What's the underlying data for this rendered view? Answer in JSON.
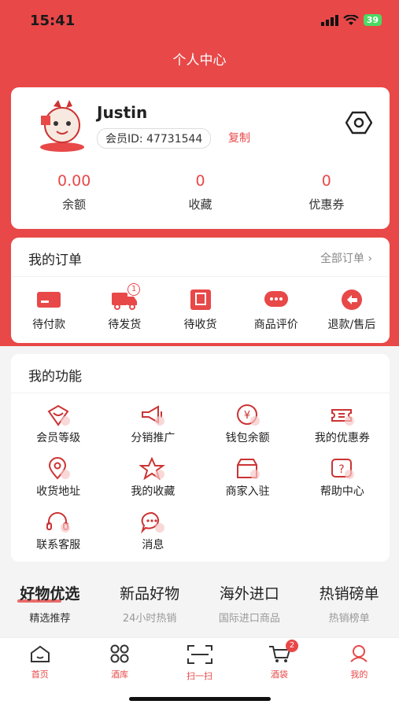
{
  "status": {
    "time": "15:41",
    "battery": "39"
  },
  "page_title": "个人中心",
  "profile": {
    "username": "Justin",
    "member_id": "会员ID: 47731544",
    "copy_label": "复制",
    "stats": [
      {
        "value": "0.00",
        "label": "余额"
      },
      {
        "value": "0",
        "label": "收藏"
      },
      {
        "value": "0",
        "label": "优惠券"
      }
    ]
  },
  "orders": {
    "title": "我的订单",
    "all_label": "全部订单 ›",
    "items": [
      {
        "label": "待付款",
        "icon": "card-icon"
      },
      {
        "label": "待发货",
        "icon": "truck-icon",
        "badge": "1"
      },
      {
        "label": "待收货",
        "icon": "box-icon"
      },
      {
        "label": "商品评价",
        "icon": "chat-icon"
      },
      {
        "label": "退款/售后",
        "icon": "return-icon"
      }
    ]
  },
  "functions": {
    "title": "我的功能",
    "items": [
      {
        "label": "会员等级"
      },
      {
        "label": "分销推广"
      },
      {
        "label": "钱包余额"
      },
      {
        "label": "我的优惠券"
      },
      {
        "label": "收货地址"
      },
      {
        "label": "我的收藏"
      },
      {
        "label": "商家入驻"
      },
      {
        "label": "帮助中心"
      },
      {
        "label": "联系客服"
      },
      {
        "label": "消息"
      }
    ]
  },
  "tabs": [
    {
      "title": "好物优选",
      "sub": "精选推荐"
    },
    {
      "title": "新品好物",
      "sub": "24小时热销"
    },
    {
      "title": "海外进口",
      "sub": "国际进口商品"
    },
    {
      "title": "热销磅单",
      "sub": "热销榜单"
    }
  ],
  "bottom_nav": [
    {
      "label": "首页"
    },
    {
      "label": "酒库"
    },
    {
      "label": "扫一扫"
    },
    {
      "label": "酒袋",
      "badge": "2"
    },
    {
      "label": "我的"
    }
  ],
  "colors": {
    "accent": "#e84848"
  }
}
